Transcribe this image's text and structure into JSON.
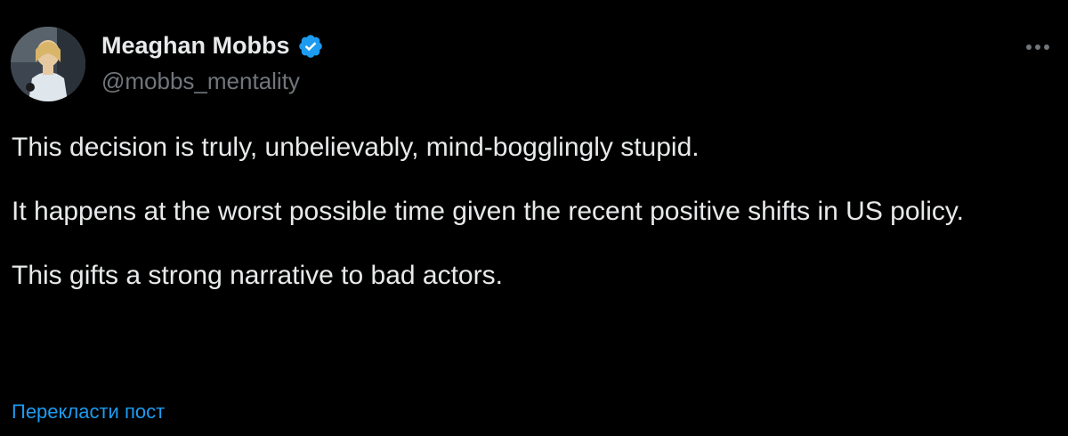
{
  "author": {
    "display_name": "Meaghan Mobbs",
    "handle": "@mobbs_mentality",
    "verified": true,
    "avatar_icon": "profile-photo"
  },
  "post": {
    "paragraphs": [
      "This decision is truly, unbelievably, mind-bogglingly stupid.",
      "It happens at the worst possible time given the recent positive shifts in US policy.",
      "This gifts a strong narrative to bad actors."
    ]
  },
  "actions": {
    "more_icon": "ellipsis-icon",
    "translate_label": "Перекласти пост"
  },
  "colors": {
    "background": "#000000",
    "primary_text": "#e7e9ea",
    "secondary_text": "#71767b",
    "link": "#1d9bf0",
    "verified_badge": "#1d9bf0"
  }
}
